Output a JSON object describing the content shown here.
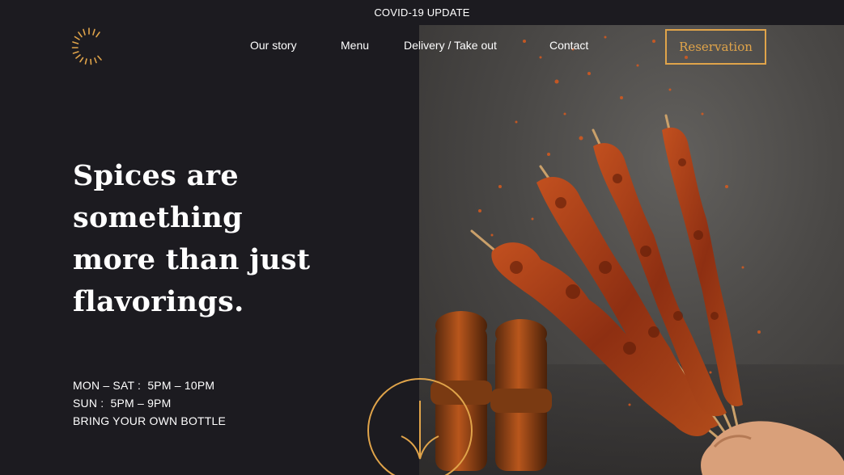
{
  "banner": {
    "covid_label": "COVID-19 UPDATE"
  },
  "brand": {
    "logo_icon": "sunburst-logo-icon",
    "accent_color": "#e0a44a",
    "background_color": "#1c1b20"
  },
  "nav": {
    "items": [
      {
        "label": "Our story"
      },
      {
        "label": "Menu"
      },
      {
        "label": "Delivery / Take out"
      },
      {
        "label": "Contact"
      }
    ],
    "reservation_label": "Reservation"
  },
  "hero": {
    "headline_lines": [
      "Spices are",
      "something",
      "more than just",
      "flavorings."
    ],
    "hours": [
      "MON – SAT :  5PM – 10PM",
      "SUN :  5PM – 9PM",
      "BRING YOUR OWN BOTTLE"
    ],
    "scroll_icon": "arrow-down-icon",
    "photo_subject": "spice-dusted meat skewers with pepper shakers"
  }
}
